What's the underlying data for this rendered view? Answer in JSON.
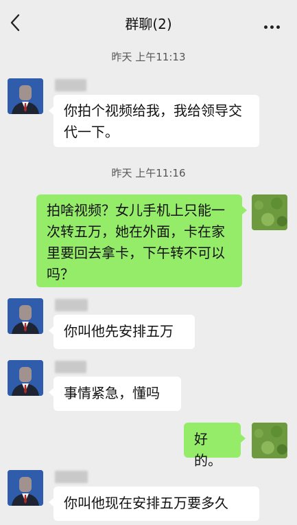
{
  "header": {
    "title": "群聊(2)"
  },
  "messages": [
    {
      "kind": "time",
      "text": "昨天 上午11:13"
    },
    {
      "kind": "in",
      "text": "你拍个视频给我，我给领导交代一下。"
    },
    {
      "kind": "time",
      "text": "昨天 上午11:16"
    },
    {
      "kind": "out",
      "text": "拍啥视频？女儿手机上只能一次转五万，她在外面，卡在家里要回去拿卡，下午转不可以吗？"
    },
    {
      "kind": "in",
      "text": "你叫他先安排五万"
    },
    {
      "kind": "in",
      "text": "事情紧急，懂吗"
    },
    {
      "kind": "out",
      "text": "好的。"
    },
    {
      "kind": "in",
      "text": "你叫他现在安排五万要多久"
    }
  ],
  "colors": {
    "background": "#ededed",
    "incoming_bubble": "#ffffff",
    "outgoing_bubble": "#95ec69"
  },
  "icons": {
    "back": "chevron-left-icon",
    "more": "more-horizontal-icon"
  }
}
